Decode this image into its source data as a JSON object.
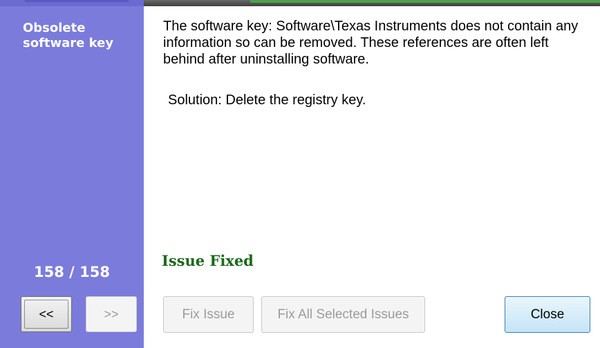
{
  "sidebar": {
    "title": "Obsolete software key",
    "counter": "158 / 158",
    "prev_label": "<<",
    "next_label": ">>"
  },
  "content": {
    "description": "The software key: Software\\Texas Instruments does not contain any information so can be removed. These references are often left behind after uninstalling software.",
    "solution": "Solution: Delete the registry key.",
    "status": "Issue Fixed"
  },
  "buttons": {
    "fix_issue": "Fix Issue",
    "fix_all": "Fix All Selected Issues",
    "close": "Close"
  },
  "colors": {
    "sidebar": "#7b7bdc",
    "status_text": "#1a6a1a",
    "close_border": "#3c7fb1"
  }
}
